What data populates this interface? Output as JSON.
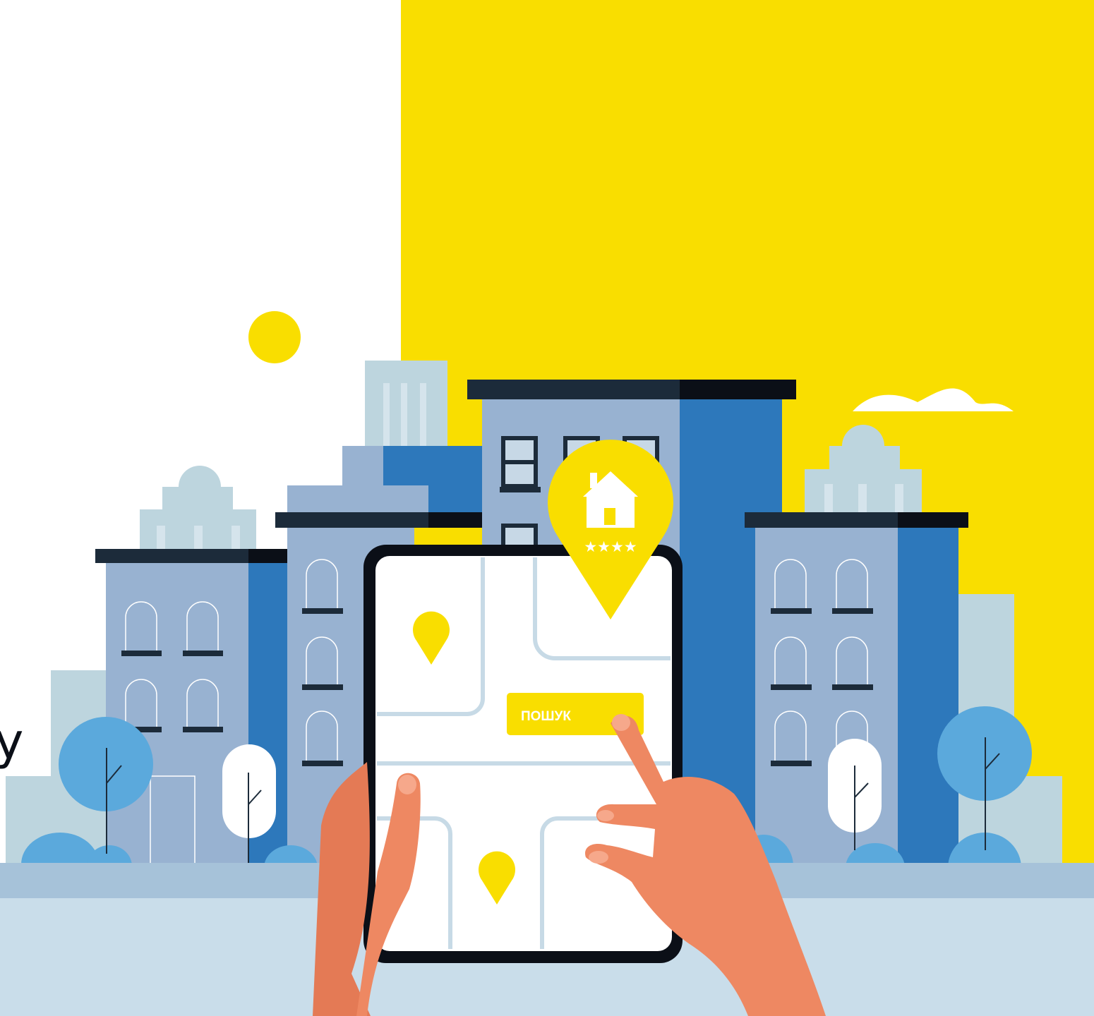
{
  "colors": {
    "yellow": "#F9DE00",
    "building_light": "#98B2D1",
    "building_dark": "#2D78BB",
    "roof": "#1C2B3A",
    "ghost": "#BDD5DE",
    "street": "#A6C2D9",
    "pavement": "#C9DDEA",
    "skin": "#EE8862",
    "tree": "#5BA9DC"
  },
  "tablet": {
    "search_button_label": "ПОШУК",
    "map_pins": [
      "map-pin",
      "map-pin"
    ]
  },
  "hotel_pin": {
    "icon": "house-icon",
    "stars": "★★★★"
  },
  "edge_fragment": "у"
}
